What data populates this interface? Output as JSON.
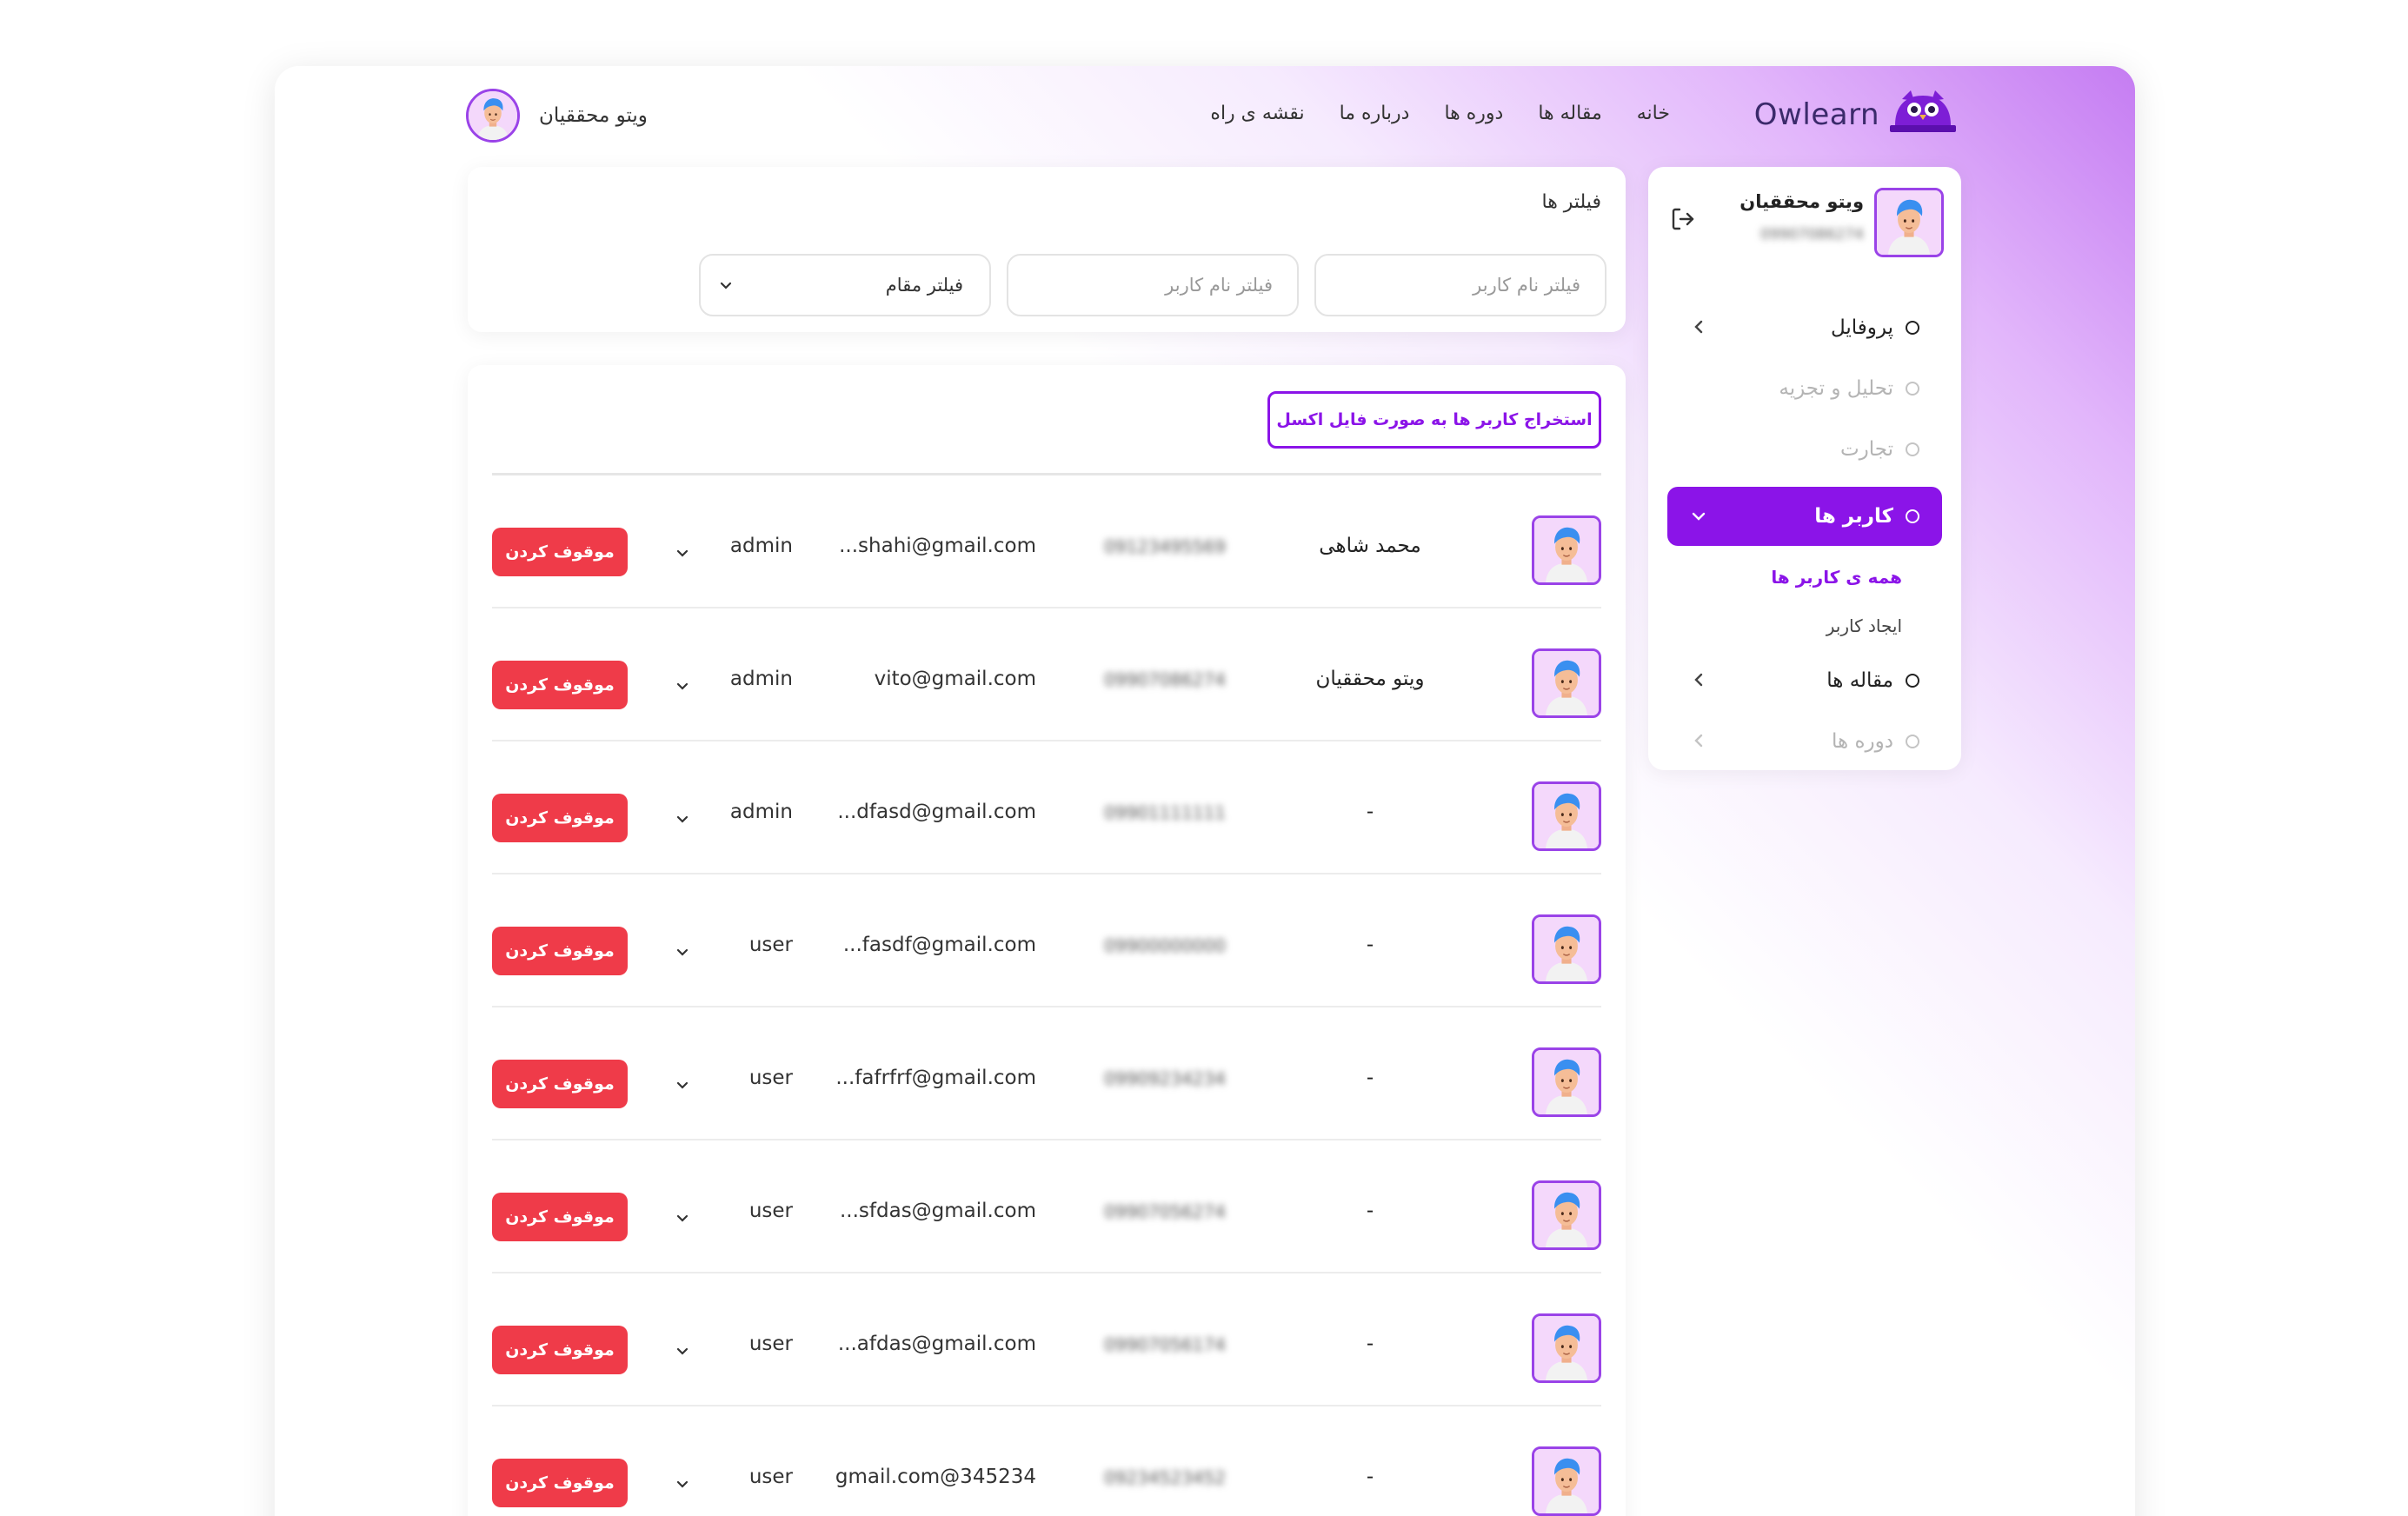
{
  "brand": {
    "name": "Owlearn",
    "accent": "#8b14e8",
    "danger": "#ef3b49"
  },
  "nav": {
    "links": [
      "خانه",
      "مقاله ها",
      "دوره ها",
      "درباره ما",
      "نقشه ی راه"
    ],
    "user_name": "ویتو محققیان"
  },
  "sidebar": {
    "user_name": "ویتو محققیان",
    "user_phone": "09907086274",
    "items": [
      {
        "label": "پروفایل",
        "has_chevron": true,
        "state": "normal"
      },
      {
        "label": "تحلیل و تجزیه",
        "has_chevron": false,
        "state": "disabled"
      },
      {
        "label": "تجارت",
        "has_chevron": false,
        "state": "disabled"
      },
      {
        "label": "کاربر ها",
        "has_chevron": true,
        "state": "active"
      },
      {
        "label": "مقاله ها",
        "has_chevron": true,
        "state": "normal"
      },
      {
        "label": "دوره ها",
        "has_chevron": true,
        "state": "disabled"
      }
    ],
    "sub_items": [
      {
        "label": "همه ی کاربر ها",
        "current": true
      },
      {
        "label": "ایجاد کاربر",
        "current": false
      }
    ]
  },
  "filters": {
    "title": "فیلتر ها",
    "username_placeholder_1": "فیلتر نام کاربر",
    "username_placeholder_2": "فیلتر نام کاربر",
    "role_select_value": "فیلتر مقام"
  },
  "users_panel": {
    "export_label": "استخراج کاربر ها به صورت فایل اکسل",
    "suspend_label": "موقوف کردن",
    "rows": [
      {
        "name": "محمد شاهی",
        "phone": "09123495569",
        "email": "...shahi@gmail.com",
        "role": "admin"
      },
      {
        "name": "ویتو محققیان",
        "phone": "09907086274",
        "email": "vito@gmail.com",
        "role": "admin"
      },
      {
        "name": "-",
        "phone": "09901111111",
        "email": "...dfasd@gmail.com",
        "role": "admin"
      },
      {
        "name": "-",
        "phone": "09900000000",
        "email": "...fasdf@gmail.com",
        "role": "user"
      },
      {
        "name": "-",
        "phone": "09909234234",
        "email": "...fafrfrf@gmail.com",
        "role": "user"
      },
      {
        "name": "-",
        "phone": "09907056274",
        "email": "...sfdas@gmail.com",
        "role": "user"
      },
      {
        "name": "-",
        "phone": "09907056174",
        "email": "...afdas@gmail.com",
        "role": "user"
      },
      {
        "name": "-",
        "phone": "09234523452",
        "email": "gmail.com@345234",
        "role": "user"
      }
    ]
  }
}
